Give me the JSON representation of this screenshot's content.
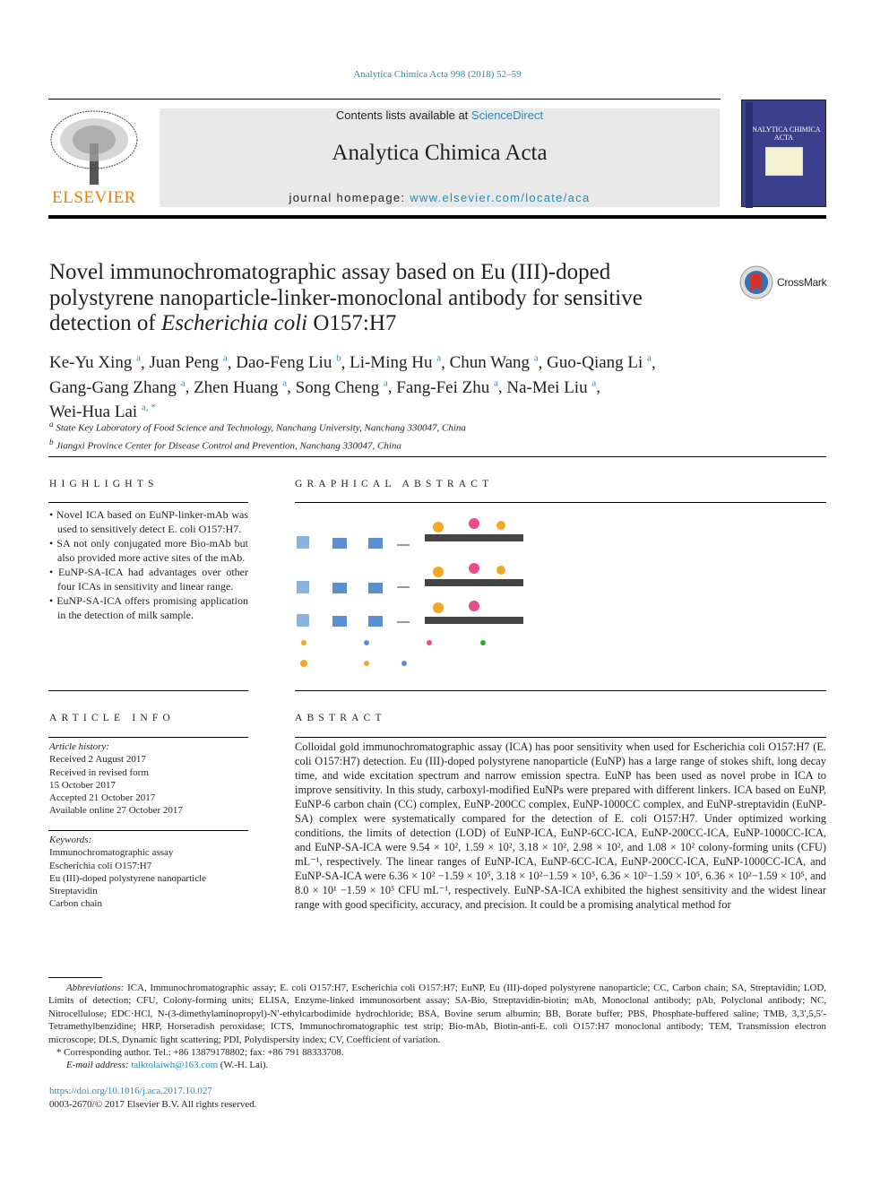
{
  "header": {
    "journal_ref": "Analytica Chimica Acta 998 (2018) 52–59",
    "contents_prefix": "Contents lists available at ",
    "contents_link": "ScienceDirect",
    "journal_title": "Analytica Chimica Acta",
    "homepage_prefix": "journal homepage: ",
    "homepage_link": "www.elsevier.com/locate/aca",
    "publisher": "ELSEVIER",
    "cover_title": "ANALYTICA CHIMICA ACTA",
    "crossmark": "CrossMark"
  },
  "article": {
    "title_part1": "Novel immunochromatographic assay based on Eu (III)-doped polystyrene nanoparticle-linker-monoclonal antibody for sensitive detection of ",
    "title_italic": "Escherichia coli",
    "title_part2": " O157:H7",
    "authors": [
      {
        "name": "Ke-Yu Xing",
        "aff": "a"
      },
      {
        "name": "Juan Peng",
        "aff": "a"
      },
      {
        "name": "Dao-Feng Liu",
        "aff": "b"
      },
      {
        "name": "Li-Ming Hu",
        "aff": "a"
      },
      {
        "name": "Chun Wang",
        "aff": "a"
      },
      {
        "name": "Guo-Qiang Li",
        "aff": "a"
      },
      {
        "name": "Gang-Gang Zhang",
        "aff": "a"
      },
      {
        "name": "Zhen Huang",
        "aff": "a"
      },
      {
        "name": "Song Cheng",
        "aff": "a"
      },
      {
        "name": "Fang-Fei Zhu",
        "aff": "a"
      },
      {
        "name": "Na-Mei Liu",
        "aff": "a"
      },
      {
        "name": "Wei-Hua Lai",
        "aff": "a, *"
      }
    ],
    "affiliations": [
      {
        "mark": "a",
        "text": "State Key Laboratory of Food Science and Technology, Nanchang University, Nanchang 330047, China"
      },
      {
        "mark": "b",
        "text": "Jiangxi Province Center for Disease Control and Prevention, Nanchang 330047, China"
      }
    ]
  },
  "highlights": {
    "heading": "HIGHLIGHTS",
    "items": [
      "Novel ICA based on EuNP-linker-mAb was used to sensitively detect E. coli O157:H7.",
      "SA not only conjugated more Bio-mAb but also provided more active sites of the mAb.",
      "EuNP-SA-ICA had advantages over other four ICAs in sensitivity and linear range.",
      "EuNP-SA-ICA offers promising application in the detection of milk sample."
    ]
  },
  "graphical_abstract": {
    "heading": "GRAPHICAL ABSTRACT"
  },
  "article_info": {
    "heading": "ARTICLE INFO",
    "history_label": "Article history:",
    "history": [
      "Received 2 August 2017",
      "Received in revised form",
      "15 October 2017",
      "Accepted 21 October 2017",
      "Available online 27 October 2017"
    ],
    "keywords_label": "Keywords:",
    "keywords": [
      "Immunochromatographic assay",
      "Escherichia coli O157:H7",
      "Eu (III)-doped polystyrene nanoparticle",
      "Streptavidin",
      "Carbon chain"
    ]
  },
  "abstract": {
    "heading": "ABSTRACT",
    "text": "Colloidal gold immunochromatographic assay (ICA) has poor sensitivity when used for Escherichia coli O157:H7 (E. coli O157:H7) detection. Eu (III)-doped polystyrene nanoparticle (EuNP) has a large range of stokes shift, long decay time, and wide excitation spectrum and narrow emission spectra. EuNP has been used as novel probe in ICA to improve sensitivity. In this study, carboxyl-modified EuNPs were prepared with different linkers. ICA based on EuNP, EuNP-6 carbon chain (CC) complex, EuNP-200CC complex, EuNP-1000CC complex, and EuNP-streptavidin (EuNP-SA) complex were systematically compared for the detection of E. coli O157:H7. Under optimized working conditions, the limits of detection (LOD) of EuNP-ICA, EuNP-6CC-ICA, EuNP-200CC-ICA, EuNP-1000CC-ICA, and EuNP-SA-ICA were 9.54 × 10², 1.59 × 10², 3.18 × 10², 2.98 × 10², and 1.08 × 10² colony-forming units (CFU) mL⁻¹, respectively. The linear ranges of EuNP-ICA, EuNP-6CC-ICA, EuNP-200CC-ICA, EuNP-1000CC-ICA, and EuNP-SA-ICA were 6.36 × 10² −1.59 × 10⁵, 3.18 × 10²−1.59 × 10⁵, 6.36 × 10²−1.59 × 10⁵, 6.36 × 10²−1.59 × 10⁵, and 8.0 × 10¹ −1.59 × 10⁵ CFU mL⁻¹, respectively. EuNP-SA-ICA exhibited the highest sensitivity and the widest linear range with good specificity, accuracy, and precision. It could be a promising analytical method for"
  },
  "footnotes": {
    "abbreviations_label": "Abbreviations:",
    "abbreviations": " ICA, Immunochromatographic assay; E. coli O157:H7, Escherichia coli O157:H7; EuNP, Eu (III)-doped polystyrene nanoparticle; CC, Carbon chain; SA, Streptavidin; LOD, Limits of detection; CFU, Colony-forming units; ELISA, Enzyme-linked immunosorbent assay; SA-Bio, Streptavidin-biotin; mAb, Monoclonal antibody; pAb, Polyclonal antibody; NC, Nitrocellulose; EDC·HCl, N-(3-dimethylaminopropyl)-N′-ethylcarbodimide hydrochloride; BSA, Bovine serum albumin; BB, Borate buffer; PBS, Phosphate-buffered saline; TMB, 3,3′,5,5′-Tetramethylbenzidine; HRP, Horseradish peroxidase; ICTS, Immunochromatographic test strip; Bio-mAb, Biotin-anti-E. coli O157:H7 monoclonal antibody; TEM, Transmission electron microscope; DLS, Dynamic light scattering; PDI, Polydispersity index; CV, Coefficient of variation.",
    "corresponding": "* Corresponding author. Tel.: +86 13879178802; fax: +86 791 88333708.",
    "email_label": "E-mail address: ",
    "email": "talktolaiwh@163.com",
    "email_suffix": " (W.-H. Lai).",
    "doi": "https://doi.org/10.1016/j.aca.2017.10.027",
    "copyright": "0003-2670/© 2017 Elsevier B.V. All rights reserved."
  },
  "colors": {
    "link": "#2a8ab8",
    "publisher_orange": "#f07c00",
    "band_gray": "#e9e9e9"
  }
}
